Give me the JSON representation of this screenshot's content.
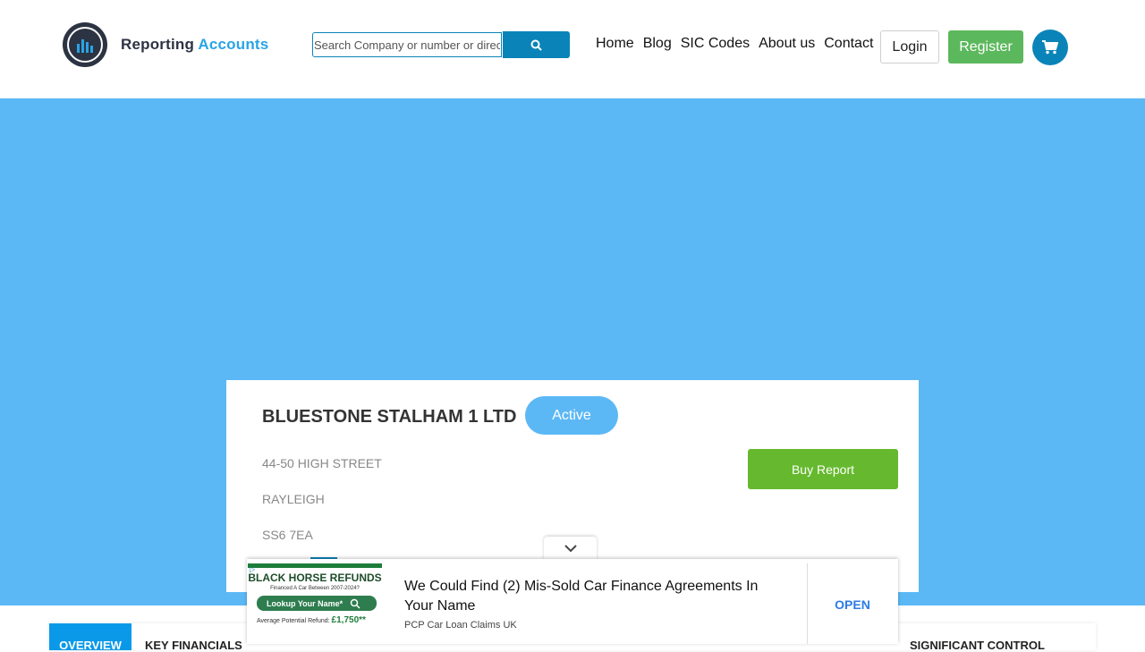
{
  "header": {
    "logo": {
      "primary": "Reporting",
      "accent": "Accounts"
    },
    "search": {
      "placeholder": "Search Company or number or director"
    },
    "nav": [
      {
        "label": "Home"
      },
      {
        "label": "Blog"
      },
      {
        "label": "SIC Codes"
      },
      {
        "label": "About us"
      },
      {
        "label": "Contact"
      }
    ],
    "login_label": "Login",
    "register_label": "Register"
  },
  "company": {
    "name": "BLUESTONE STALHAM 1 LTD",
    "status": "Active",
    "address": [
      "44-50 HIGH STREET",
      "RAYLEIGH",
      "SS6 7EA"
    ],
    "buy_report_label": "Buy Report"
  },
  "tabs": [
    {
      "label": "OVERVIEW"
    },
    {
      "label": "KEY FINANCIALS"
    },
    {
      "label": "SIGNIFICANT CONTROL"
    }
  ],
  "ad": {
    "brand": "BLACK HORSE REFUNDS",
    "sub": "Financed A Car Between 2007-2024?",
    "lookup_label": "Lookup Your Name*",
    "refund_label": "Average Potential Refund:",
    "refund_value": "£1,750**",
    "headline": "We Could Find (2) Mis-Sold Car Finance Agreements In Your Name",
    "advertiser": "PCP Car Loan Claims UK",
    "open_label": "OPEN"
  },
  "colors": {
    "hero": "#5cb8f5",
    "primary": "#0a84b8",
    "register": "#5cb85c",
    "buy": "#66b92e"
  }
}
